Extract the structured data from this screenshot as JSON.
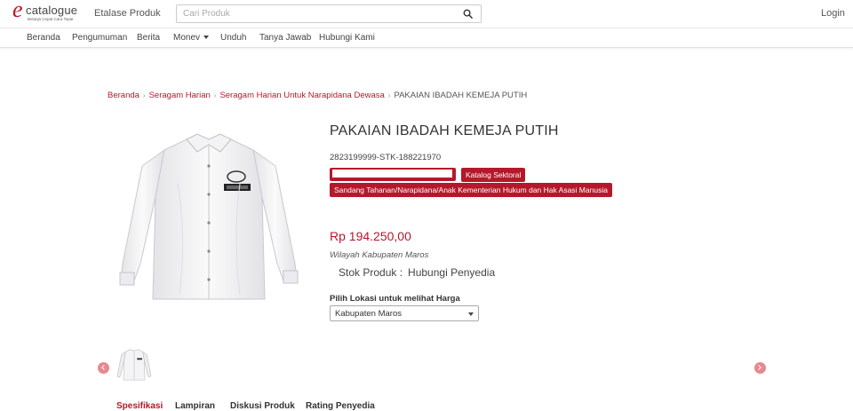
{
  "header": {
    "logo_text": "catalogue",
    "logo_tagline": "Belanja Cepat Cara Tepat",
    "etalase_label": "Etalase Produk",
    "search_placeholder": "Cari Produk",
    "login_label": "Login"
  },
  "nav": {
    "items": [
      "Beranda",
      "Pengumuman",
      "Berita",
      "Monev",
      "Unduh",
      "Tanya Jawab",
      "Hubungi Kami"
    ]
  },
  "breadcrumb": {
    "items": [
      "Beranda",
      "Seragam Harian",
      "Seragam Harian Untuk Narapidana Dewasa",
      "PAKAIAN IBADAH KEMEJA PUTIH"
    ]
  },
  "product": {
    "title": "PAKAIAN IBADAH KEMEJA PUTIH",
    "code": "2823199999-STK-188221970",
    "badges": {
      "catalog": "Katalog Sektoral",
      "category": "Sandang Tahanan/Narapidana/Anak Kementerian Hukum dan Hak Asasi Manusia"
    },
    "price": "Rp 194.250,00",
    "region": "Wilayah Kabupaten Maros",
    "stock_label": "Stok Produk :",
    "stock_value": "Hubungi Penyedia",
    "location_label": "Pilih Lokasi untuk melihat Harga",
    "location_selected": "Kabupaten Maros"
  },
  "tabs": [
    "Spesifikasi",
    "Lampiran",
    "Diskusi Produk",
    "Rating Penyedia"
  ],
  "colors": {
    "brand_red": "#b5182b",
    "arrow_pink": "#e8888f"
  }
}
